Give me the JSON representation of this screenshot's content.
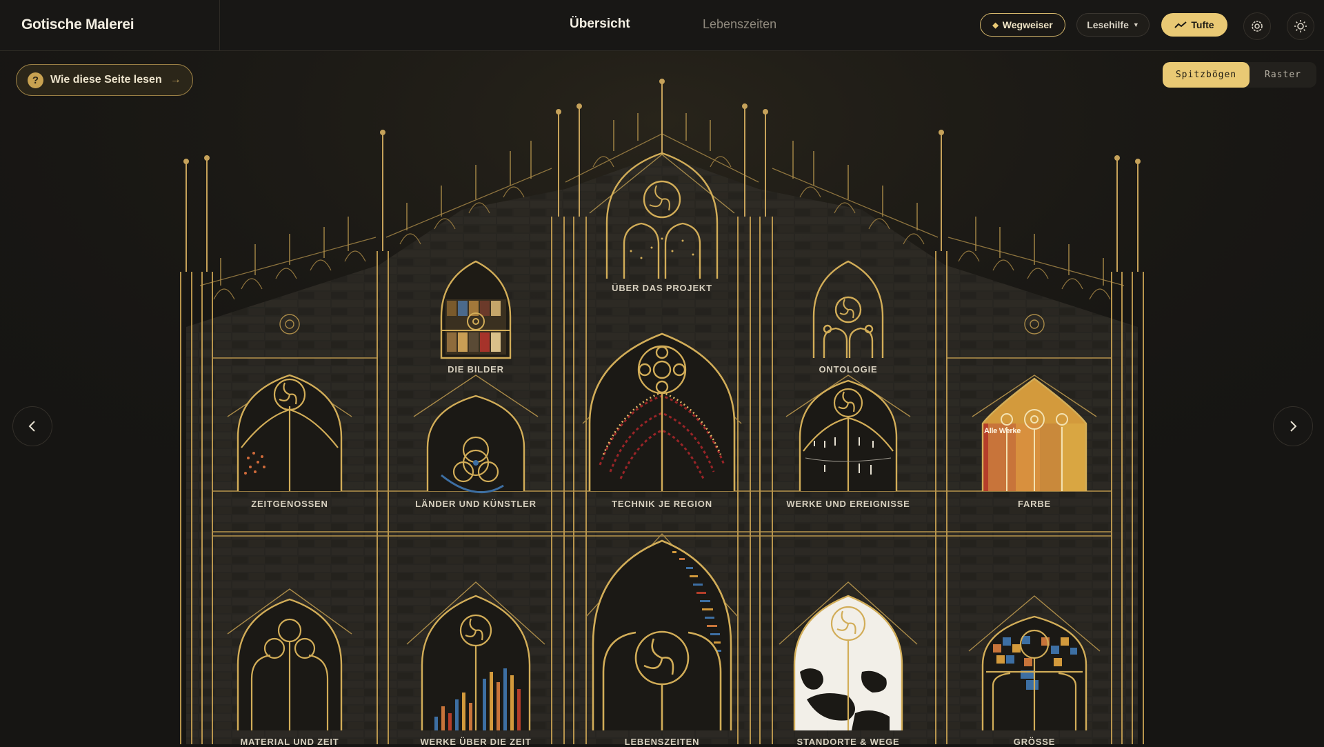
{
  "app": {
    "title": "Gotische Malerei"
  },
  "nav": {
    "tabs": [
      {
        "label": "Übersicht",
        "active": true
      },
      {
        "label": "Lebenszeiten",
        "active": false
      }
    ]
  },
  "toolbar": {
    "guide_label": "Wegweiser",
    "reading_help_label": "Lesehilfe",
    "tufte_label": "Tufte",
    "icons": [
      "settings-icon",
      "sun-icon"
    ]
  },
  "help": {
    "label": "Wie diese Seite lesen",
    "arrow": "→",
    "badge": "?"
  },
  "view_toggle": {
    "options": [
      "Spitzbögen",
      "Raster"
    ],
    "selected": "Spitzbögen"
  },
  "windows": [
    {
      "label": "ÜBER DAS PROJEKT"
    },
    {
      "label": "DIE BILDER"
    },
    {
      "label": "ONTOLOGIE"
    },
    {
      "label": "ZEITGENOSSEN"
    },
    {
      "label": "LÄNDER UND KÜNSTLER"
    },
    {
      "label": "TECHNIK JE REGION"
    },
    {
      "label": "WERKE UND EREIGNISSE"
    },
    {
      "label": "FARBE",
      "inner_text": "Alle Werke"
    },
    {
      "label": "MATERIAL UND ZEIT"
    },
    {
      "label": "WERKE ÜBER DIE ZEIT"
    },
    {
      "label": "LEBENSZEITEN"
    },
    {
      "label": "STANDORTE & WEGE"
    },
    {
      "label": "GRÖSSE"
    }
  ],
  "colors": {
    "gold": "#d2ad58",
    "accent": "#e9c974",
    "background": "#161513"
  }
}
